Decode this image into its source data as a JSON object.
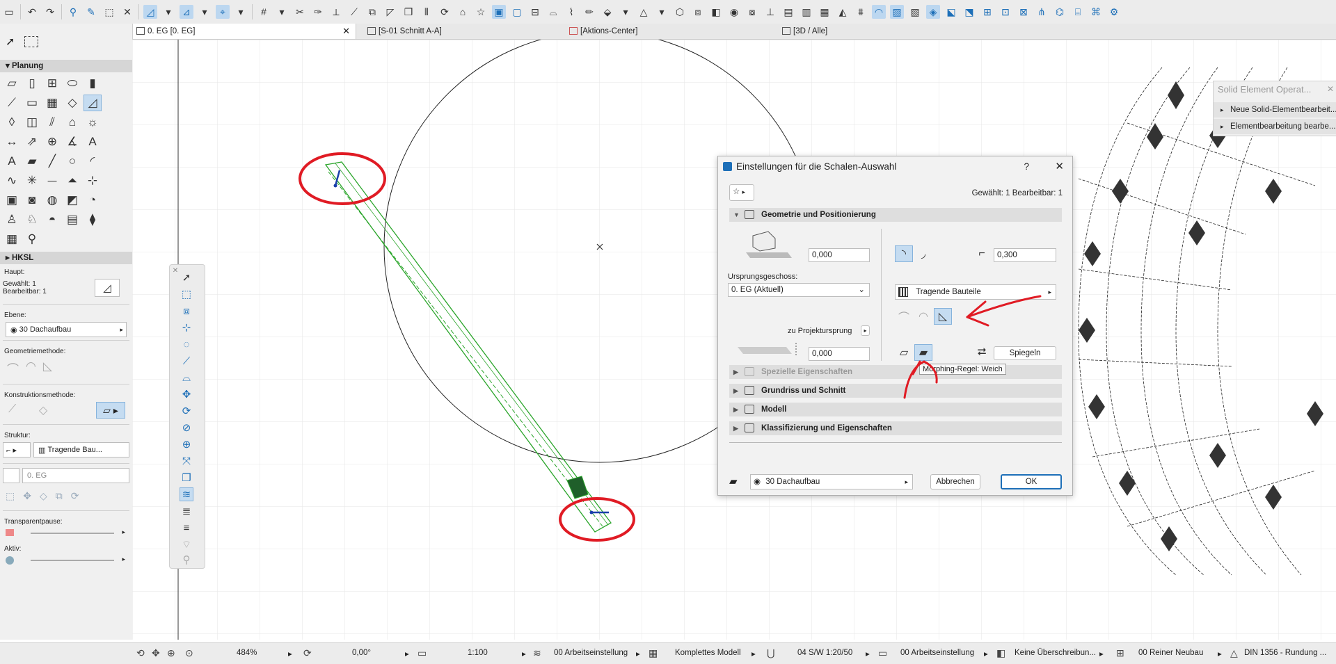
{
  "tabs": [
    {
      "label": "0. EG [0. EG]",
      "active": true
    },
    {
      "label": "[S-01 Schnitt A-A]",
      "active": false
    },
    {
      "label": "[Aktions-Center]",
      "active": false
    },
    {
      "label": "[3D / Alle]",
      "active": false
    }
  ],
  "palette": {
    "section_planung": "Planung",
    "section_hksl": "HKSL",
    "haupt_label": "Haupt:",
    "gewaehlt": "Gewählt: 1",
    "bearbeitbar": "Bearbeitbar: 1",
    "ebene_label": "Ebene:",
    "ebene_value": "30 Dachaufbau",
    "geometriemethode_label": "Geometriemethode:",
    "konstruktionsmethode_label": "Konstruktionsmethode:",
    "struktur_label": "Struktur:",
    "struktur_value": "Tragende Bau...",
    "geschoss_value": "0. EG",
    "transparentpause_label": "Transparentpause:",
    "aktiv_label": "Aktiv:"
  },
  "dialog": {
    "title": "Einstellungen für die Schalen-Auswahl",
    "help": "?",
    "close": "✕",
    "selection_info": "Gewählt: 1 Bearbeitbar: 1",
    "sections": {
      "geometrie": "Geometrie und Positionierung",
      "spezielle": "Spezielle Eigenschaften",
      "grundriss": "Grundriss und Schnitt",
      "modell": "Modell",
      "klassifizierung": "Klassifizierung und Eigenschaften"
    },
    "offset_top": "0,000",
    "ursprungsgeschoss_label": "Ursprungsgeschoss:",
    "ursprungsgeschoss_value": "0. EG (Aktuell)",
    "zu_projektursprung": "zu Projektursprung",
    "offset_bottom": "0,000",
    "thickness": "0,300",
    "structure": "Tragende Bauteile",
    "spiegeln": "Spiegeln",
    "tooltip": "Morphing-Regel: Weich",
    "layer": "30 Dachaufbau",
    "cancel": "Abbrechen",
    "ok": "OK"
  },
  "solid_panel": {
    "title": "Solid Element Operat...",
    "item1": "Neue Solid-Elementbearbeit...",
    "item2": "Elementbearbeitung bearbe..."
  },
  "status": {
    "zoom": "484%",
    "angle": "0,00°",
    "scale": "1:100",
    "arbeitseinstellung1": "00 Arbeitseinstellung",
    "modell": "Komplettes Modell",
    "stift": "04 S/W 1:20/50",
    "arbeitseinstellung2": "00 Arbeitseinstellung",
    "ueberschreibung": "Keine Überschreibun...",
    "neubau": "00 Reiner Neubau",
    "din": "DIN 1356 - Rundung ..."
  },
  "colors": {
    "accent": "#1d6fb8",
    "selection_green": "#2aa52a",
    "annotation_red": "#e01b24"
  }
}
